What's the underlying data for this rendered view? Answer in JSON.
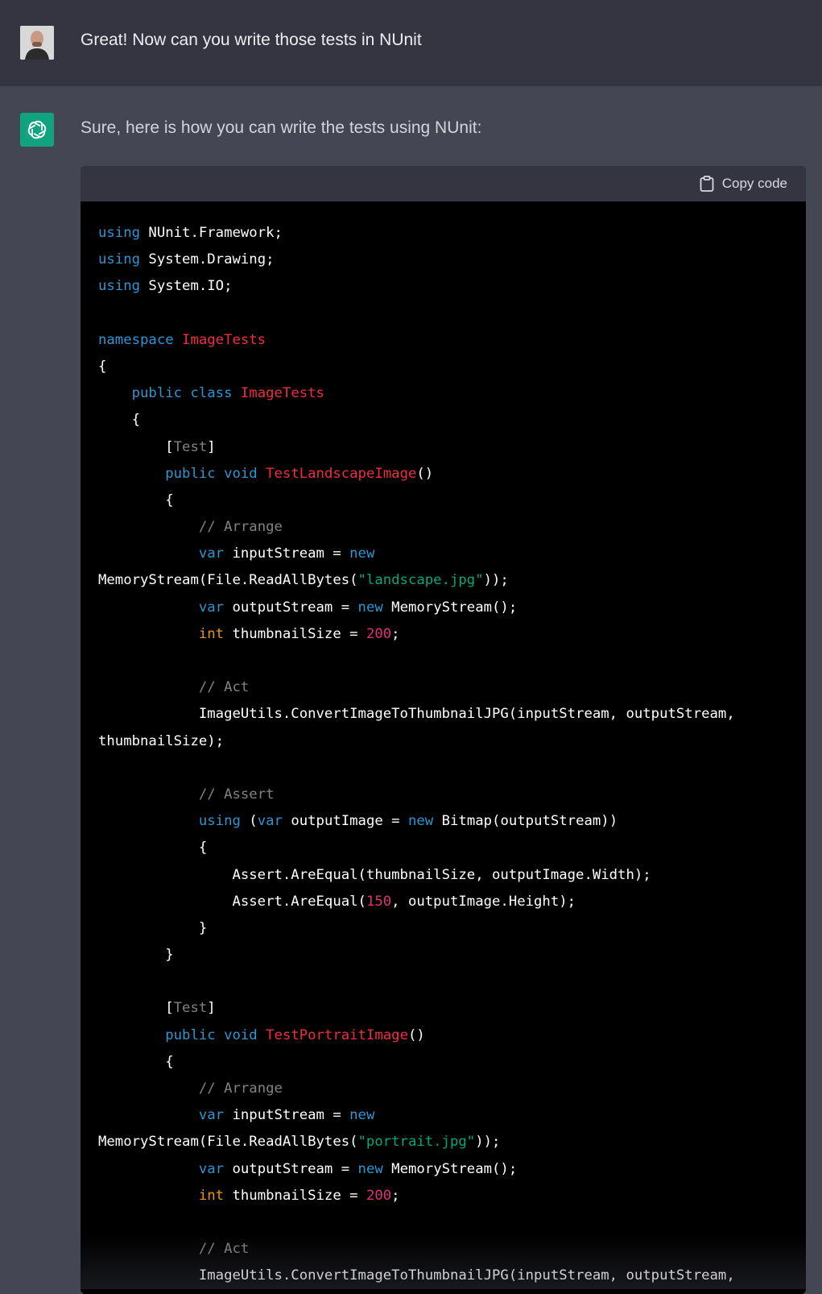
{
  "user_message": {
    "text": "Great! Now can you write those tests in NUnit"
  },
  "assistant_message": {
    "intro": "Sure, here is how you can write the tests using NUnit:",
    "code_block": {
      "copy_label": "Copy code",
      "lines": [
        [
          [
            "using",
            "keyword"
          ],
          [
            " NUnit.Framework;",
            ""
          ]
        ],
        [
          [
            "using",
            "keyword"
          ],
          [
            " System.Drawing;",
            ""
          ]
        ],
        [
          [
            "using",
            "keyword"
          ],
          [
            " System.IO;",
            ""
          ]
        ],
        [],
        [
          [
            "namespace",
            "keyword"
          ],
          [
            " ",
            ""
          ],
          [
            "ImageTests",
            "title"
          ]
        ],
        [
          [
            "{",
            ""
          ]
        ],
        [
          [
            "    ",
            ""
          ],
          [
            "public",
            "keyword"
          ],
          [
            " ",
            ""
          ],
          [
            "class",
            "keyword"
          ],
          [
            " ",
            ""
          ],
          [
            "ImageTests",
            "class"
          ]
        ],
        [
          [
            "    {",
            ""
          ]
        ],
        [
          [
            "        [",
            ""
          ],
          [
            "Test",
            "attr"
          ],
          [
            "]",
            ""
          ]
        ],
        [
          [
            "        ",
            ""
          ],
          [
            "public",
            "keyword"
          ],
          [
            " ",
            ""
          ],
          [
            "void",
            "keyword"
          ],
          [
            " ",
            ""
          ],
          [
            "TestLandscapeImage",
            "title"
          ],
          [
            "()",
            ""
          ]
        ],
        [
          [
            "        {",
            ""
          ]
        ],
        [
          [
            "            ",
            ""
          ],
          [
            "// Arrange",
            "comment"
          ]
        ],
        [
          [
            "            ",
            ""
          ],
          [
            "var",
            "keyword"
          ],
          [
            " inputStream = ",
            ""
          ],
          [
            "new",
            "keyword"
          ]
        ],
        [
          [
            "MemoryStream(File.ReadAllBytes(",
            ""
          ],
          [
            "\"landscape.jpg\"",
            "string"
          ],
          [
            "));",
            ""
          ]
        ],
        [
          [
            "            ",
            ""
          ],
          [
            "var",
            "keyword"
          ],
          [
            " outputStream = ",
            ""
          ],
          [
            "new",
            "keyword"
          ],
          [
            " MemoryStream();",
            ""
          ]
        ],
        [
          [
            "            ",
            ""
          ],
          [
            "int",
            "int"
          ],
          [
            " thumbnailSize = ",
            ""
          ],
          [
            "200",
            "number"
          ],
          [
            ";",
            ""
          ]
        ],
        [],
        [
          [
            "            ",
            ""
          ],
          [
            "// Act",
            "comment"
          ]
        ],
        [
          [
            "            ImageUtils.ConvertImageToThumbnailJPG(inputStream, outputStream,",
            ""
          ]
        ],
        [
          [
            "thumbnailSize);",
            ""
          ]
        ],
        [],
        [
          [
            "            ",
            ""
          ],
          [
            "// Assert",
            "comment"
          ]
        ],
        [
          [
            "            ",
            ""
          ],
          [
            "using",
            "keyword"
          ],
          [
            " (",
            ""
          ],
          [
            "var",
            "keyword"
          ],
          [
            " outputImage = ",
            ""
          ],
          [
            "new",
            "keyword"
          ],
          [
            " Bitmap(outputStream))",
            ""
          ]
        ],
        [
          [
            "            {",
            ""
          ]
        ],
        [
          [
            "                Assert.AreEqual(thumbnailSize, outputImage.Width);",
            ""
          ]
        ],
        [
          [
            "                Assert.AreEqual(",
            ""
          ],
          [
            "150",
            "number"
          ],
          [
            ", outputImage.Height);",
            ""
          ]
        ],
        [
          [
            "            }",
            ""
          ]
        ],
        [
          [
            "        }",
            ""
          ]
        ],
        [],
        [
          [
            "        [",
            ""
          ],
          [
            "Test",
            "attr"
          ],
          [
            "]",
            ""
          ]
        ],
        [
          [
            "        ",
            ""
          ],
          [
            "public",
            "keyword"
          ],
          [
            " ",
            ""
          ],
          [
            "void",
            "keyword"
          ],
          [
            " ",
            ""
          ],
          [
            "TestPortraitImage",
            "title"
          ],
          [
            "()",
            ""
          ]
        ],
        [
          [
            "        {",
            ""
          ]
        ],
        [
          [
            "            ",
            ""
          ],
          [
            "// Arrange",
            "comment"
          ]
        ],
        [
          [
            "            ",
            ""
          ],
          [
            "var",
            "keyword"
          ],
          [
            " inputStream = ",
            ""
          ],
          [
            "new",
            "keyword"
          ]
        ],
        [
          [
            "MemoryStream(File.ReadAllBytes(",
            ""
          ],
          [
            "\"portrait.jpg\"",
            "string"
          ],
          [
            "));",
            ""
          ]
        ],
        [
          [
            "            ",
            ""
          ],
          [
            "var",
            "keyword"
          ],
          [
            " outputStream = ",
            ""
          ],
          [
            "new",
            "keyword"
          ],
          [
            " MemoryStream();",
            ""
          ]
        ],
        [
          [
            "            ",
            ""
          ],
          [
            "int",
            "int"
          ],
          [
            " thumbnailSize = ",
            ""
          ],
          [
            "200",
            "number"
          ],
          [
            ";",
            ""
          ]
        ],
        [],
        [
          [
            "            ",
            ""
          ],
          [
            "// Act",
            "comment"
          ]
        ],
        [
          [
            "            ImageUtils.ConvertImageToThumbnailJPG(inputStream, outputStream,",
            ""
          ]
        ]
      ]
    }
  },
  "icons": {
    "user_avatar": "user-avatar",
    "assistant_logo": "openai-logo-icon",
    "copy": "clipboard-icon"
  },
  "colors": {
    "user_row_bg": "#343541",
    "assistant_row_bg": "#444654",
    "code_bg": "#000000",
    "code_header_bg": "#343541",
    "brand_green": "#10a37f",
    "keyword": "#2e95d3",
    "title": "#f22c3d",
    "string": "#00a67d",
    "number": "#df3079",
    "int_type": "#e9950c"
  }
}
